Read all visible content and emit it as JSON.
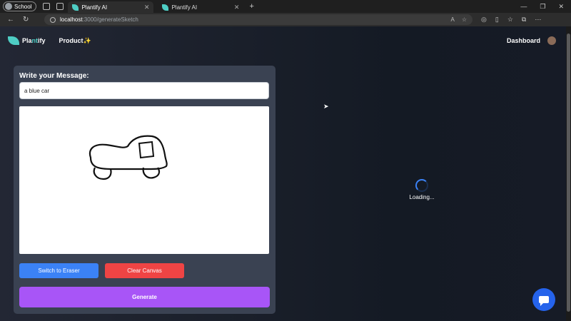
{
  "browser": {
    "profile_label": "School",
    "tabs": [
      {
        "title": "Plantify AI",
        "active": true
      },
      {
        "title": "Plantify AI",
        "active": false
      }
    ],
    "url_host": "localhost",
    "url_path": ":3000/generateSketch"
  },
  "navbar": {
    "logo_part1": "Pla",
    "logo_part2": "nt",
    "logo_part3": "ify",
    "product_label": "Product✨",
    "dashboard_label": "Dashboard"
  },
  "form": {
    "label": "Write your Message:",
    "input_value": "a blue car",
    "eraser_button": "Switch to Eraser",
    "clear_button": "Clear Canvas",
    "generate_button": "Generate"
  },
  "status": {
    "loading_text": "Loading..."
  },
  "colors": {
    "accent": "#4ecdc4",
    "eraser": "#3b82f6",
    "clear": "#ef4444",
    "generate": "#a855f7",
    "chat": "#2563eb"
  },
  "icons": [
    "back-icon",
    "refresh-icon",
    "info-icon",
    "chat-icon",
    "leaf-logo-icon"
  ]
}
